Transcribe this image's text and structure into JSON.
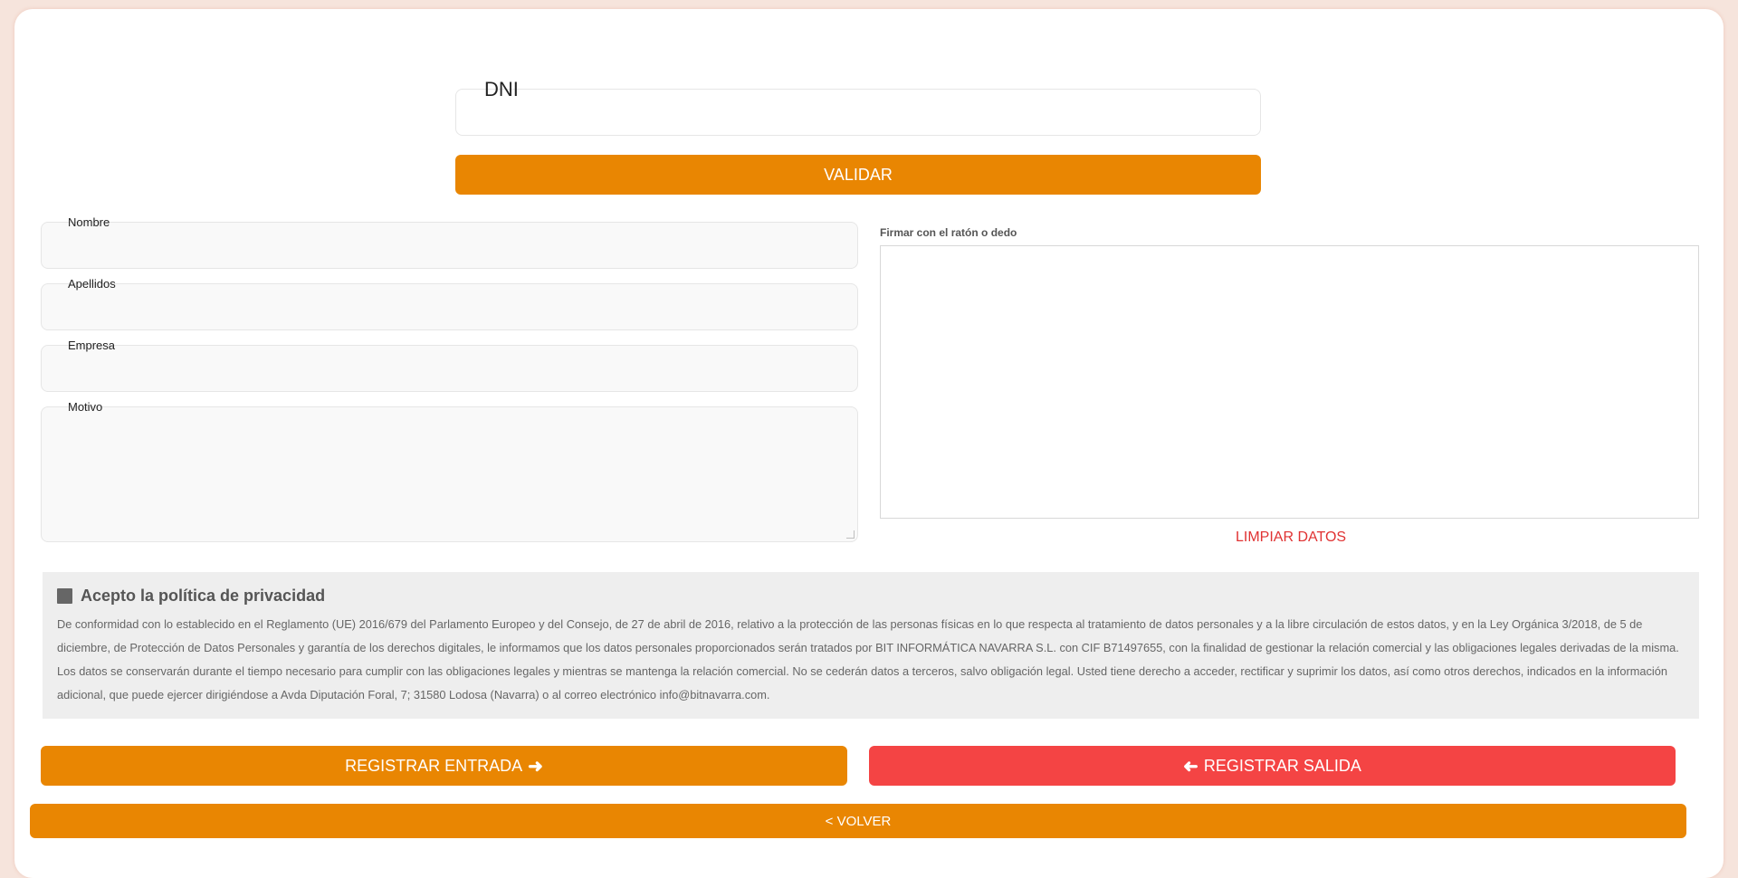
{
  "dni": {
    "label": "DNI",
    "value": ""
  },
  "validate_button": "VALIDAR",
  "fields": {
    "nombre": {
      "label": "Nombre",
      "value": ""
    },
    "apellidos": {
      "label": "Apellidos",
      "value": ""
    },
    "empresa": {
      "label": "Empresa",
      "value": ""
    },
    "motivo": {
      "label": "Motivo",
      "value": ""
    }
  },
  "signature": {
    "label": "Firmar con el ratón o dedo",
    "clear_label": "LIMPIAR DATOS"
  },
  "privacy": {
    "checkbox_label": "Acepto la política de privacidad",
    "checked": false,
    "text": "De conformidad con lo establecido en el Reglamento (UE) 2016/679 del Parlamento Europeo y del Consejo, de 27 de abril de 2016, relativo a la protección de las personas físicas en lo que respecta al tratamiento de datos personales y a la libre circulación de estos datos, y en la Ley Orgánica 3/2018, de 5 de diciembre, de Protección de Datos Personales y garantía de los derechos digitales, le informamos que los datos personales proporcionados serán tratados por BIT INFORMÁTICA NAVARRA S.L. con CIF B71497655, con la finalidad de gestionar la relación comercial y las obligaciones legales derivadas de la misma. Los datos se conservarán durante el tiempo necesario para cumplir con las obligaciones legales y mientras se mantenga la relación comercial. No se cederán datos a terceros, salvo obligación legal. Usted tiene derecho a acceder, rectificar y suprimir los datos, así como otros derechos, indicados en la información adicional, que puede ejercer dirigiéndose a Avda Diputación Foral, 7; 31580 Lodosa (Navarra) o al correo electrónico info@bitnavarra.com."
  },
  "actions": {
    "entrada_label": "REGISTRAR ENTRADA",
    "entrada_icon": "arrow-right-icon",
    "salida_label": "REGISTRAR SALIDA",
    "salida_icon": "arrow-left-icon",
    "volver_label": "< VOLVER"
  },
  "colors": {
    "accent": "#e98602",
    "danger": "#f44444",
    "clear_link": "#e03232"
  }
}
